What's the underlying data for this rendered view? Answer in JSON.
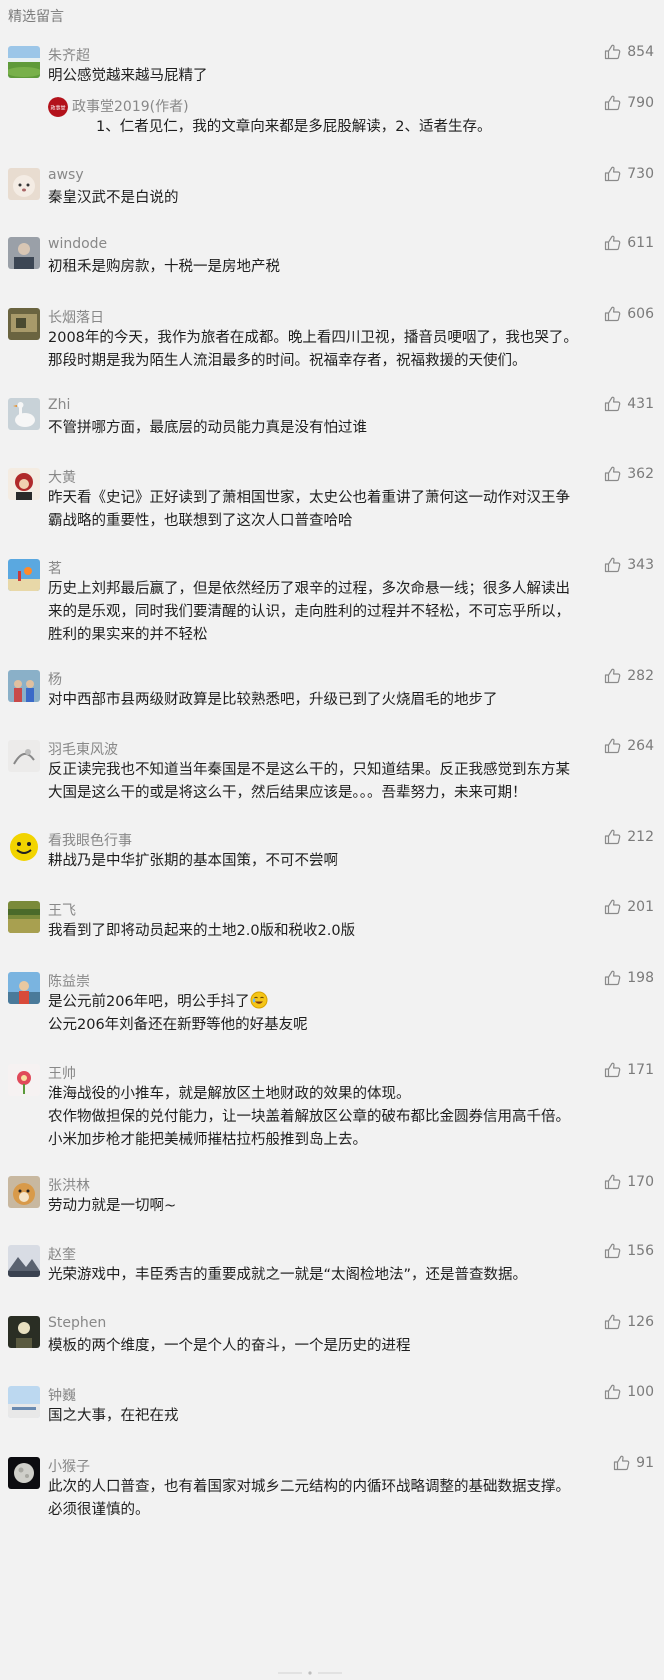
{
  "header": {
    "title": "精选留言"
  },
  "comments": [
    {
      "name": "朱齐超",
      "likes": "854",
      "text": "明公感觉越来越马屁精了",
      "avatar": "avatar-landscape-icon"
    },
    {
      "name": "awsy",
      "likes": "730",
      "text": "秦皇汉武不是白说的",
      "avatar": "avatar-puppy-icon"
    },
    {
      "name": "windode",
      "likes": "611",
      "text": "初租禾是购房款，十税一是房地产税",
      "avatar": "avatar-person-icon"
    },
    {
      "name": "长烟落日",
      "likes": "606",
      "text": "2008年的今天，我作为旅者在成都。晚上看四川卫视，播音员哽咽了，我也哭了。\n那段时期是我为陌生人流泪最多的时间。祝福幸存者，祝福救援的天使们。",
      "avatar": "avatar-photo-icon"
    },
    {
      "name": "Zhi",
      "likes": "431",
      "text": "不管拼哪方面，最底层的动员能力真是没有怕过谁",
      "avatar": "avatar-goose-icon"
    },
    {
      "name": "大黄",
      "likes": "362",
      "text": "昨天看《史记》正好读到了萧相国世家，太史公也着重讲了萧何这一动作对汉王争\n霸战略的重要性，也联想到了这次人口普查哈哈",
      "avatar": "avatar-character-icon"
    },
    {
      "name": "茗",
      "likes": "343",
      "text": "历史上刘邦最后赢了，但是依然经历了艰辛的过程，多次命悬一线；很多人解读出\n来的是乐观，同时我们要清醒的认识，走向胜利的过程并不轻松，不可忘乎所以，\n胜利的果实来的并不轻松",
      "avatar": "avatar-beach-icon"
    },
    {
      "name": "杨",
      "likes": "282",
      "text": "对中西部市县两级财政算是比较熟悉吧，升级已到了火烧眉毛的地步了",
      "avatar": "avatar-family-icon"
    },
    {
      "name": "羽毛東风波",
      "likes": "264",
      "text": "反正读完我也不知道当年秦国是不是这么干的，只知道结果。反正我感觉到东方某\n大国是这么干的或是将这么干，然后结果应该是。。。吾辈努力，未来可期！",
      "avatar": "avatar-sketch-icon"
    },
    {
      "name": "看我眼色行事",
      "likes": "212",
      "text": "耕战乃是中华扩张期的基本国策，不可不尝啊",
      "avatar": "avatar-smiley-icon"
    },
    {
      "name": "王飞",
      "likes": "201",
      "text": "我看到了即将动员起来的土地2.0版和税收2.0版",
      "avatar": "avatar-field-icon"
    },
    {
      "name": "陈益崇",
      "likes": "198",
      "text": "是公元前206年吧，明公手抖了",
      "text2": "公元206年刘备还在新野等他的好基友呢",
      "avatar": "avatar-sky-icon",
      "emoji": "laugh-cry-emoji-icon"
    },
    {
      "name": "王帅",
      "likes": "171",
      "text": "淮海战役的小推车，就是解放区土地财政的效果的体现。\n农作物做担保的兑付能力，让一块盖着解放区公章的破布都比金圆券信用高千倍。\n小米加步枪才能把美械师摧枯拉朽般推到岛上去。",
      "avatar": "avatar-flower-icon"
    },
    {
      "name": "张洪林",
      "likes": "170",
      "text": "劳动力就是一切啊~",
      "avatar": "avatar-dog-icon"
    },
    {
      "name": "赵奎",
      "likes": "156",
      "text": "光荣游戏中，丰臣秀吉的重要成就之一就是“太阁检地法”，还是普查数据。",
      "avatar": "avatar-mountain-icon"
    },
    {
      "name": "Stephen",
      "likes": "126",
      "text": "模板的两个维度，一个是个人的奋斗，一个是历史的进程",
      "avatar": "avatar-silhouette-icon"
    },
    {
      "name": "钟巍",
      "likes": "100",
      "text": "国之大事，在祀在戎",
      "avatar": "avatar-building-icon"
    },
    {
      "name": "小猴子",
      "likes": "91",
      "text": "此次的人口普查，也有着国家对城乡二元结构的内循环战略调整的基础数据支撑。\n必须很谨慎的。",
      "avatar": "avatar-moon-icon"
    }
  ],
  "reply": {
    "name": "政事堂2019(作者)",
    "likes": "790",
    "text": "1、仁者见仁，我的文章向来都是多屁股解读，2、适者生存。",
    "avatar": "author-logo-icon",
    "logo_text": "政事堂"
  }
}
